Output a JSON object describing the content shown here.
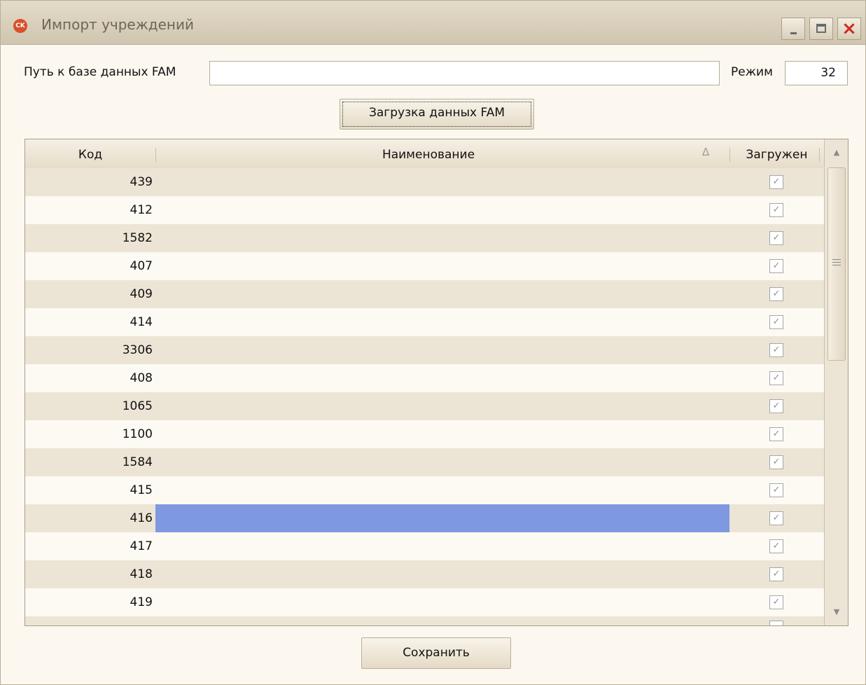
{
  "window": {
    "title": "Импорт учреждений",
    "icon": "app-logo-icon"
  },
  "titlebar_buttons": {
    "minimize": "minimize-icon",
    "maximize": "maximize-icon",
    "close": "×"
  },
  "form": {
    "path_label": "Путь к базе данных FAM",
    "path_value": "",
    "mode_label": "Режим",
    "mode_value": "32",
    "load_button": "Загрузка данных FAM"
  },
  "grid": {
    "columns": [
      "Код",
      "Наименование",
      "Загружен"
    ],
    "sort_indicator": "Δ",
    "rows": [
      {
        "code": "439",
        "name": "",
        "loaded": true
      },
      {
        "code": "412",
        "name": "",
        "loaded": true
      },
      {
        "code": "1582",
        "name": "",
        "loaded": true
      },
      {
        "code": "407",
        "name": "",
        "loaded": true
      },
      {
        "code": "409",
        "name": "",
        "loaded": true
      },
      {
        "code": "414",
        "name": "",
        "loaded": true
      },
      {
        "code": "3306",
        "name": "",
        "loaded": true
      },
      {
        "code": "408",
        "name": "",
        "loaded": true
      },
      {
        "code": "1065",
        "name": "",
        "loaded": true
      },
      {
        "code": "1100",
        "name": "",
        "loaded": true
      },
      {
        "code": "1584",
        "name": "",
        "loaded": true
      },
      {
        "code": "415",
        "name": "",
        "loaded": true
      },
      {
        "code": "416",
        "name": "",
        "loaded": true,
        "selected": true
      },
      {
        "code": "417",
        "name": "",
        "loaded": true
      },
      {
        "code": "418",
        "name": "",
        "loaded": true
      },
      {
        "code": "419",
        "name": "",
        "loaded": true
      }
    ],
    "selected_color": "#7e99e0"
  },
  "save_button": "Сохранить",
  "colors": {
    "window_bg": "#fcf8f0",
    "stripe": "#ece5d6",
    "close": "#cf2b1a"
  }
}
